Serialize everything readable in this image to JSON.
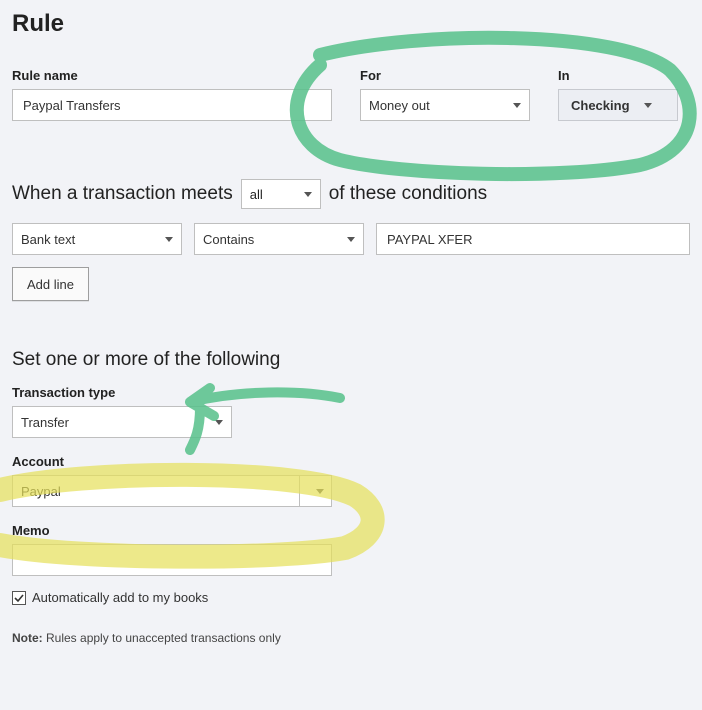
{
  "header": {
    "title": "Rule"
  },
  "top": {
    "rule_name_label": "Rule name",
    "rule_name_value": "Paypal Transfers",
    "for_label": "For",
    "for_value": "Money out",
    "in_label": "In",
    "in_value": "Checking"
  },
  "conditions": {
    "prefix": "When a transaction meets",
    "scope": "all",
    "suffix": "of these conditions",
    "rows": [
      {
        "field": "Bank text",
        "op": "Contains",
        "value": "PAYPAL XFER"
      }
    ],
    "add_line_label": "Add line"
  },
  "set": {
    "heading": "Set one or more of the following",
    "txn_type_label": "Transaction type",
    "txn_type_value": "Transfer",
    "account_label": "Account",
    "account_value": "Paypal",
    "memo_label": "Memo",
    "memo_value": ""
  },
  "auto_add": {
    "checked": true,
    "label": "Automatically add to my books"
  },
  "note": {
    "prefix": "Note:",
    "text": " Rules apply to unaccepted transactions only"
  }
}
